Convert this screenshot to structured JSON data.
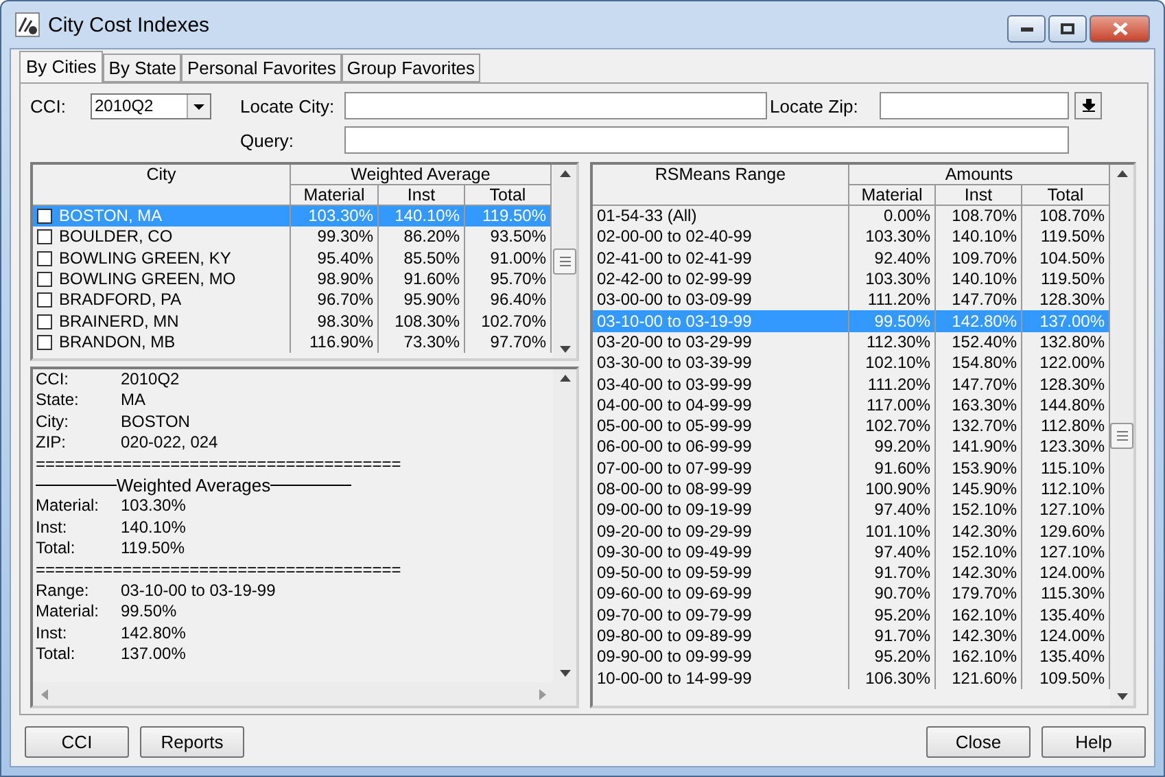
{
  "window": {
    "title": "City Cost Indexes"
  },
  "tabs": [
    {
      "label": "By Cities",
      "selected": true
    },
    {
      "label": "By State",
      "selected": false
    },
    {
      "label": "Personal Favorites",
      "selected": false
    },
    {
      "label": "Group Favorites",
      "selected": false
    }
  ],
  "filters": {
    "cci_label": "CCI:",
    "cci_value": "2010Q2",
    "city_label": "Locate City:",
    "zip_label": "Locate Zip:",
    "query_label": "Query:"
  },
  "city_table": {
    "columns": {
      "city": "City",
      "group": "Weighted Average",
      "material": "Material",
      "inst": "Inst",
      "total": "Total"
    },
    "rows": [
      {
        "city": "BOSTON, MA",
        "material": "103.30%",
        "inst": "140.10%",
        "total": "119.50%",
        "checked": false,
        "selected": true
      },
      {
        "city": "BOULDER, CO",
        "material": "99.30%",
        "inst": "86.20%",
        "total": "93.50%",
        "checked": false,
        "selected": false
      },
      {
        "city": "BOWLING GREEN, KY",
        "material": "95.40%",
        "inst": "85.50%",
        "total": "91.00%",
        "checked": false,
        "selected": false
      },
      {
        "city": "BOWLING GREEN, MO",
        "material": "98.90%",
        "inst": "91.60%",
        "total": "95.70%",
        "checked": false,
        "selected": false
      },
      {
        "city": "BRADFORD, PA",
        "material": "96.70%",
        "inst": "95.90%",
        "total": "96.40%",
        "checked": false,
        "selected": false
      },
      {
        "city": "BRAINERD, MN",
        "material": "98.30%",
        "inst": "108.30%",
        "total": "102.70%",
        "checked": false,
        "selected": false
      },
      {
        "city": "BRANDON, MB",
        "material": "116.90%",
        "inst": "73.30%",
        "total": "97.70%",
        "checked": false,
        "selected": false
      }
    ]
  },
  "details": [
    {
      "kind": "field",
      "label": "CCI:",
      "value": "2010Q2"
    },
    {
      "kind": "field",
      "label": "State:",
      "value": "MA"
    },
    {
      "kind": "field",
      "label": "City:",
      "value": "BOSTON"
    },
    {
      "kind": "field",
      "label": "ZIP:",
      "value": "020-022, 024"
    },
    {
      "kind": "separator",
      "text": "======================================"
    },
    {
      "kind": "heading",
      "text": "Weighted Averages"
    },
    {
      "kind": "field",
      "label": "Material:",
      "value": "103.30%"
    },
    {
      "kind": "field",
      "label": "Inst:",
      "value": "140.10%"
    },
    {
      "kind": "field",
      "label": "Total:",
      "value": "119.50%"
    },
    {
      "kind": "separator",
      "text": "======================================"
    },
    {
      "kind": "field",
      "label": "Range:",
      "value": "03-10-00 to 03-19-99"
    },
    {
      "kind": "field",
      "label": "Material:",
      "value": "99.50%"
    },
    {
      "kind": "field",
      "label": "Inst:",
      "value": "142.80%"
    },
    {
      "kind": "field",
      "label": "Total:",
      "value": "137.00%"
    }
  ],
  "range_table": {
    "columns": {
      "range": "RSMeans Range",
      "group": "Amounts",
      "material": "Material",
      "inst": "Inst",
      "total": "Total"
    },
    "rows": [
      {
        "range": "01-54-33 (All)",
        "material": "0.00%",
        "inst": "108.70%",
        "total": "108.70%",
        "selected": false
      },
      {
        "range": "02-00-00 to 02-40-99",
        "material": "103.30%",
        "inst": "140.10%",
        "total": "119.50%",
        "selected": false
      },
      {
        "range": "02-41-00 to 02-41-99",
        "material": "92.40%",
        "inst": "109.70%",
        "total": "104.50%",
        "selected": false
      },
      {
        "range": "02-42-00 to 02-99-99",
        "material": "103.30%",
        "inst": "140.10%",
        "total": "119.50%",
        "selected": false
      },
      {
        "range": "03-00-00 to 03-09-99",
        "material": "111.20%",
        "inst": "147.70%",
        "total": "128.30%",
        "selected": false
      },
      {
        "range": "03-10-00 to 03-19-99",
        "material": "99.50%",
        "inst": "142.80%",
        "total": "137.00%",
        "selected": true
      },
      {
        "range": "03-20-00 to 03-29-99",
        "material": "112.30%",
        "inst": "152.40%",
        "total": "132.80%",
        "selected": false
      },
      {
        "range": "03-30-00 to 03-39-99",
        "material": "102.10%",
        "inst": "154.80%",
        "total": "122.00%",
        "selected": false
      },
      {
        "range": "03-40-00 to 03-99-99",
        "material": "111.20%",
        "inst": "147.70%",
        "total": "128.30%",
        "selected": false
      },
      {
        "range": "04-00-00 to 04-99-99",
        "material": "117.00%",
        "inst": "163.30%",
        "total": "144.80%",
        "selected": false
      },
      {
        "range": "05-00-00 to 05-99-99",
        "material": "102.70%",
        "inst": "132.70%",
        "total": "112.80%",
        "selected": false
      },
      {
        "range": "06-00-00 to 06-99-99",
        "material": "99.20%",
        "inst": "141.90%",
        "total": "123.30%",
        "selected": false
      },
      {
        "range": "07-00-00 to 07-99-99",
        "material": "91.60%",
        "inst": "153.90%",
        "total": "115.10%",
        "selected": false
      },
      {
        "range": "08-00-00 to 08-99-99",
        "material": "100.90%",
        "inst": "145.90%",
        "total": "112.10%",
        "selected": false
      },
      {
        "range": "09-00-00 to 09-19-99",
        "material": "97.40%",
        "inst": "152.10%",
        "total": "127.10%",
        "selected": false
      },
      {
        "range": "09-20-00 to 09-29-99",
        "material": "101.10%",
        "inst": "142.30%",
        "total": "129.60%",
        "selected": false
      },
      {
        "range": "09-30-00 to 09-49-99",
        "material": "97.40%",
        "inst": "152.10%",
        "total": "127.10%",
        "selected": false
      },
      {
        "range": "09-50-00 to 09-59-99",
        "material": "91.70%",
        "inst": "142.30%",
        "total": "124.00%",
        "selected": false
      },
      {
        "range": "09-60-00 to 09-69-99",
        "material": "90.70%",
        "inst": "179.70%",
        "total": "115.30%",
        "selected": false
      },
      {
        "range": "09-70-00 to 09-79-99",
        "material": "95.20%",
        "inst": "162.10%",
        "total": "135.40%",
        "selected": false
      },
      {
        "range": "09-80-00 to 09-89-99",
        "material": "91.70%",
        "inst": "142.30%",
        "total": "124.00%",
        "selected": false
      },
      {
        "range": "09-90-00 to 09-99-99",
        "material": "95.20%",
        "inst": "162.10%",
        "total": "135.40%",
        "selected": false
      },
      {
        "range": "10-00-00 to 14-99-99",
        "material": "106.30%",
        "inst": "121.60%",
        "total": "109.50%",
        "selected": false
      }
    ]
  },
  "buttons_left": [
    "CCI",
    "Reports"
  ],
  "buttons_right": [
    "Close",
    "Help"
  ]
}
